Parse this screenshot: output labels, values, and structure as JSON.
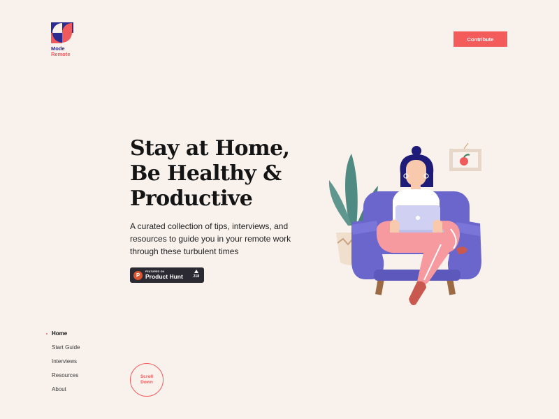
{
  "brand": {
    "line1": "Mode",
    "line2": "Remote",
    "icon": "mode-remote-logo"
  },
  "header": {
    "contribute_label": "Contribute"
  },
  "hero": {
    "title_lines": [
      "Stay at Home,",
      "Be Healthy &",
      "Productive"
    ],
    "description_lines": [
      "A curated collection of tips, interviews, and",
      "resources to guide you in your remote work",
      "through these turbulent times"
    ]
  },
  "product_hunt": {
    "logo_letter": "P",
    "featured_label": "FEATURED ON",
    "name": "Product Hunt",
    "votes": "218"
  },
  "nav": {
    "items": [
      {
        "label": "Home",
        "active": true
      },
      {
        "label": "Start Guide",
        "active": false
      },
      {
        "label": "Interviews",
        "active": false
      },
      {
        "label": "Resources",
        "active": false
      },
      {
        "label": "About",
        "active": false
      }
    ]
  },
  "scroll": {
    "line1": "Scroll",
    "line2": "Down"
  },
  "colors": {
    "background": "#f8f1ec",
    "accent": "#f45b5b",
    "navy": "#2c2b8f",
    "armchair": "#6b66cc",
    "plant": "#4f8a83"
  }
}
